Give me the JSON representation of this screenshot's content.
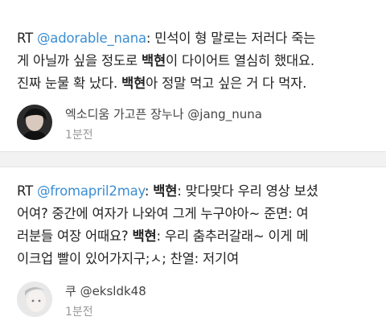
{
  "tweets": [
    {
      "lines": [
        [
          {
            "t": "RT "
          },
          {
            "t": "@adorable_nana",
            "mention": true
          },
          {
            "t": ": 민석이 형 말로는 저러다 죽는"
          }
        ],
        [
          {
            "t": "게 아닐까 싶을 정도로 "
          },
          {
            "t": "백현",
            "bold": true
          },
          {
            "t": "이 다이어트 열심히 했대요."
          }
        ],
        [
          {
            "t": "진짜 눈물 확 났다. "
          },
          {
            "t": "백현",
            "bold": true
          },
          {
            "t": "아 정말 먹고 싶은 거 다 먹자."
          }
        ]
      ],
      "author": "엑소디움 가고픈 장누나 @jang_nuna",
      "time": "1분전",
      "avatar_icon": "user-avatar-icon"
    },
    {
      "lines": [
        [
          {
            "t": "RT "
          },
          {
            "t": "@fromapril2may",
            "mention": true
          },
          {
            "t": ": "
          },
          {
            "t": "백현",
            "bold": true
          },
          {
            "t": ": 맞다맞다 우리 영상 보셨"
          }
        ],
        [
          {
            "t": "어여? 중간에 여자가 나와여 그게 누구야아~ 준면: 여"
          }
        ],
        [
          {
            "t": "러분들 여장 어때요? "
          },
          {
            "t": "백현",
            "bold": true
          },
          {
            "t": ": 우리 춤추러갈래~ 이게 메"
          }
        ],
        [
          {
            "t": "이크업 빨이 있어가지구;ㅅ; 찬열: 저기여"
          }
        ]
      ],
      "author": "쿠 @eksldk48",
      "time": "1분전",
      "avatar_icon": "user-avatar-icon"
    }
  ],
  "colors": {
    "mention": "#3b8ed3",
    "text": "#222222",
    "meta": "#999999",
    "separator": "#f2f2f2"
  }
}
